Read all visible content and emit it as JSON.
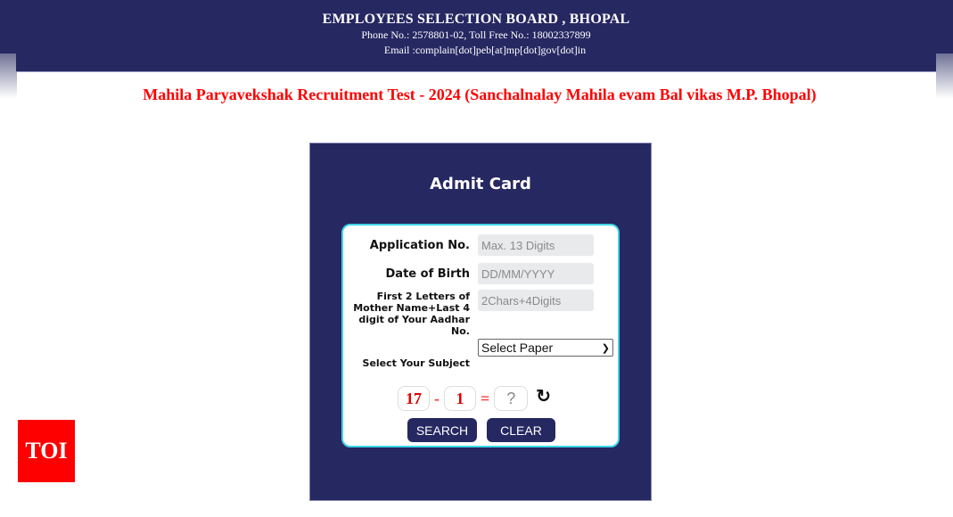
{
  "header": {
    "org_name": "EMPLOYEES SELECTION BOARD , BHOPAL",
    "phone_line": "Phone No.: 2578801-02, Toll Free No.: 18002337899",
    "email_line": "Email :complain[dot]peb[at]mp[dot]gov[dot]in"
  },
  "exam_title": "Mahila Paryavekshak Recruitment Test - 2024 (Sanchalnalay Mahila evam Bal vikas M.P. Bhopal)",
  "card": {
    "title": "Admit Card",
    "fields": {
      "application_no": {
        "label": "Application No.",
        "value": "",
        "placeholder": "Max. 13 Digits"
      },
      "dob": {
        "label": "Date of Birth",
        "value": "",
        "placeholder": "DD/MM/YYYY"
      },
      "mother_aadhar": {
        "label_lines": [
          "First 2 Letters of",
          "Mother Name+Last 4",
          "digit of Your Aadhar",
          "No."
        ],
        "value": "",
        "placeholder": "2Chars+4Digits"
      },
      "subject": {
        "label": "Select Your Subject",
        "selected": "Select Paper"
      }
    },
    "captcha": {
      "a": "17",
      "op": "-",
      "b": "1",
      "eq": "=",
      "answer_placeholder": "?"
    },
    "buttons": {
      "search": "SEARCH",
      "clear": "CLEAR"
    }
  },
  "watermark": "TOI",
  "colors": {
    "navy": "#262862",
    "accent_cyan": "#3ed6e6",
    "title_red": "#ff0000",
    "toi_red": "#ff0000"
  }
}
